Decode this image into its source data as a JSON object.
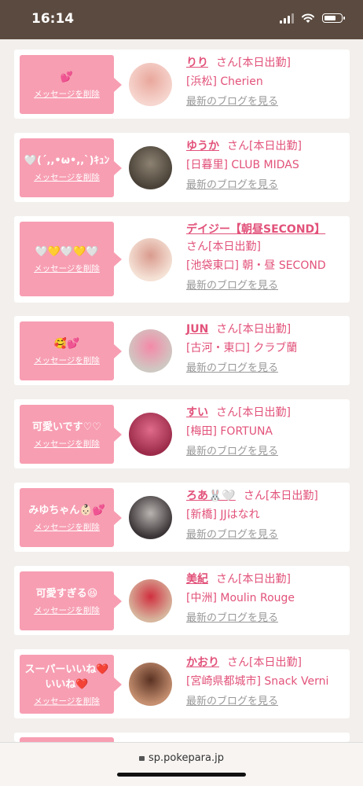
{
  "status": {
    "time": "16:14"
  },
  "cards": [
    {
      "message": "💕",
      "delete_label": "メッセージを削除",
      "name": "りり",
      "san": "さん[本日出勤]",
      "shop": "[浜松] Cherien",
      "blog": "最新のブログを見る"
    },
    {
      "message": "🤍(´,,•ω•,,`)ｷｭﾝ",
      "delete_label": "メッセージを削除",
      "name": "ゆうか",
      "san": "さん[本日出勤]",
      "shop": "[日暮里] CLUB MIDAS",
      "blog": "最新のブログを見る"
    },
    {
      "message": "🤍💛🤍💛🤍",
      "delete_label": "メッセージを削除",
      "name": "デイジー【朝昼SECOND】",
      "san": "さん[本日出勤]",
      "shop": "[池袋東口] 朝・昼 SECOND",
      "blog": "最新のブログを見る"
    },
    {
      "message": "🥰💕",
      "delete_label": "メッセージを削除",
      "name": "JUN",
      "san": "さん[本日出勤]",
      "shop": "[古河・東口] クラブ蘭",
      "blog": "最新のブログを見る"
    },
    {
      "message": "可愛いです♡♡",
      "delete_label": "メッセージを削除",
      "name": "すい",
      "san": "さん[本日出勤]",
      "shop": "[梅田] FORTUNA",
      "blog": "最新のブログを見る"
    },
    {
      "message": "みゆちゃん👶🏻💕",
      "delete_label": "メッセージを削除",
      "name": "ろあ🐰🤍",
      "san": "さん[本日出勤]",
      "shop": "[新橋] JJはなれ",
      "blog": "最新のブログを見る"
    },
    {
      "message": "可愛すぎる😆",
      "delete_label": "メッセージを削除",
      "name": "美紀",
      "san": "さん[本日出勤]",
      "shop": "[中洲] Moulin Rouge",
      "blog": "最新のブログを見る"
    },
    {
      "message": "スーパーいいね❤️\nいいね❤️",
      "delete_label": "メッセージを削除",
      "name": "かおり",
      "san": "さん[本日出勤]",
      "shop": "[宮崎県都城市] Snack Verni",
      "blog": "最新のブログを見る"
    }
  ],
  "address_bar": {
    "url": "sp.pokepara.jp"
  },
  "colors": {
    "accent": "#e2527a",
    "bubble": "#f79eb2",
    "status_bar": "#5b4a3f"
  }
}
